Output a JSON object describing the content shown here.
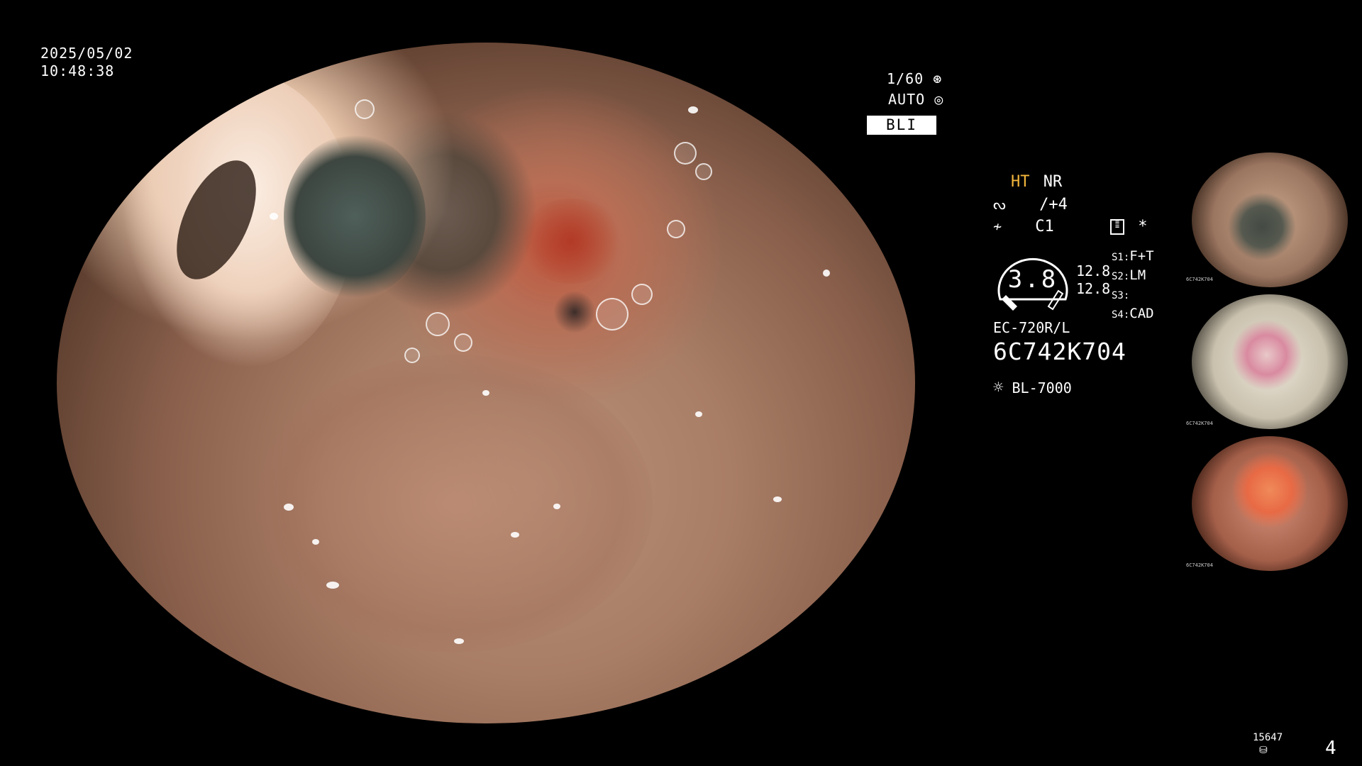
{
  "datetime": {
    "date": "2025/05/02",
    "time": "10:48:38"
  },
  "top_right": {
    "shutter": "1/60",
    "mode": "AUTO",
    "light_mode": "BLI"
  },
  "settings": {
    "enhance_a": "HT",
    "enhance_b": "NR",
    "structure": "/+4",
    "color": "C1",
    "star": "*",
    "zoom": "3.8",
    "val_1": "12.8",
    "val_2": "12.8",
    "s1_label": "S1:",
    "s1_value": "F+T",
    "s2_label": "S2:",
    "s2_value": "LM",
    "s3_label": "S3:",
    "s3_value": "",
    "s4_label": "S4:",
    "s4_value": "CAD",
    "scope_model": "EC-720R/L",
    "scope_serial": "6C742K704",
    "light_source": "BL-7000"
  },
  "thumbnails": [
    {
      "label": "6C742K704",
      "tone": "BLI"
    },
    {
      "label": "6C742K704",
      "tone": "LCI"
    },
    {
      "label": "6C742K704",
      "tone": "WLI"
    }
  ],
  "footer": {
    "count": "15647",
    "page": "4"
  },
  "colors": {
    "highlight": "#f2b53c",
    "text": "#ffffff"
  }
}
